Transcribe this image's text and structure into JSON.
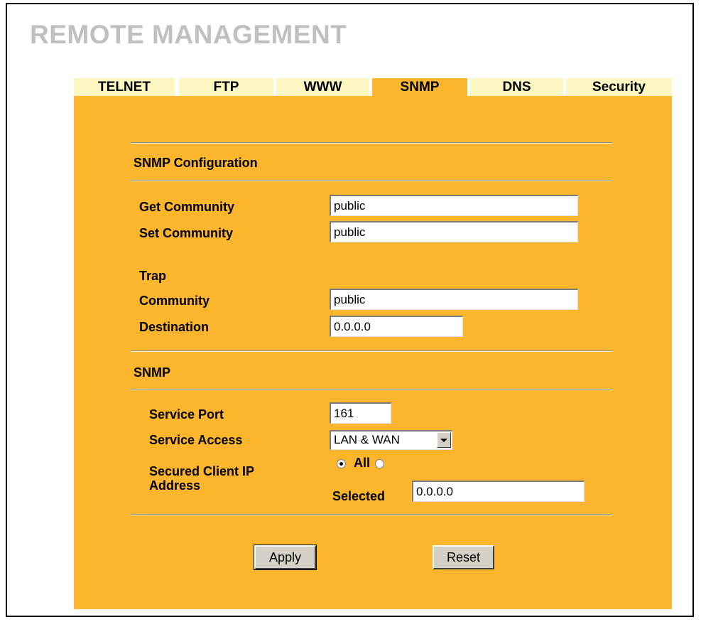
{
  "page": {
    "title": "REMOTE MANAGEMENT"
  },
  "tabs": [
    {
      "label": "TELNET",
      "active": false
    },
    {
      "label": "FTP",
      "active": false
    },
    {
      "label": "WWW",
      "active": false
    },
    {
      "label": "SNMP",
      "active": true
    },
    {
      "label": "DNS",
      "active": false
    },
    {
      "label": "Security",
      "active": false
    }
  ],
  "snmp_config": {
    "heading": "SNMP Configuration",
    "get_community": {
      "label": "Get Community",
      "value": "public"
    },
    "set_community": {
      "label": "Set Community",
      "value": "public"
    },
    "trap": {
      "label": "Trap",
      "community": {
        "label": "Community",
        "value": "public"
      },
      "destination": {
        "label": "Destination",
        "value": "0.0.0.0"
      }
    }
  },
  "snmp_service": {
    "heading": "SNMP",
    "service_port": {
      "label": "Service Port",
      "value": "161"
    },
    "service_access": {
      "label": "Service Access",
      "value": "LAN & WAN"
    },
    "secured_client_ip": {
      "label_line1": "Secured Client IP",
      "label_line2": "Address",
      "all_label": "All",
      "selected_label": "Selected",
      "selected_value": "0.0.0.0",
      "mode": "All"
    }
  },
  "buttons": {
    "apply": "Apply",
    "reset": "Reset"
  },
  "colors": {
    "panel": "#fbb62e",
    "tab_inactive": "#fdf7c2",
    "title": "#c0c0c0"
  }
}
